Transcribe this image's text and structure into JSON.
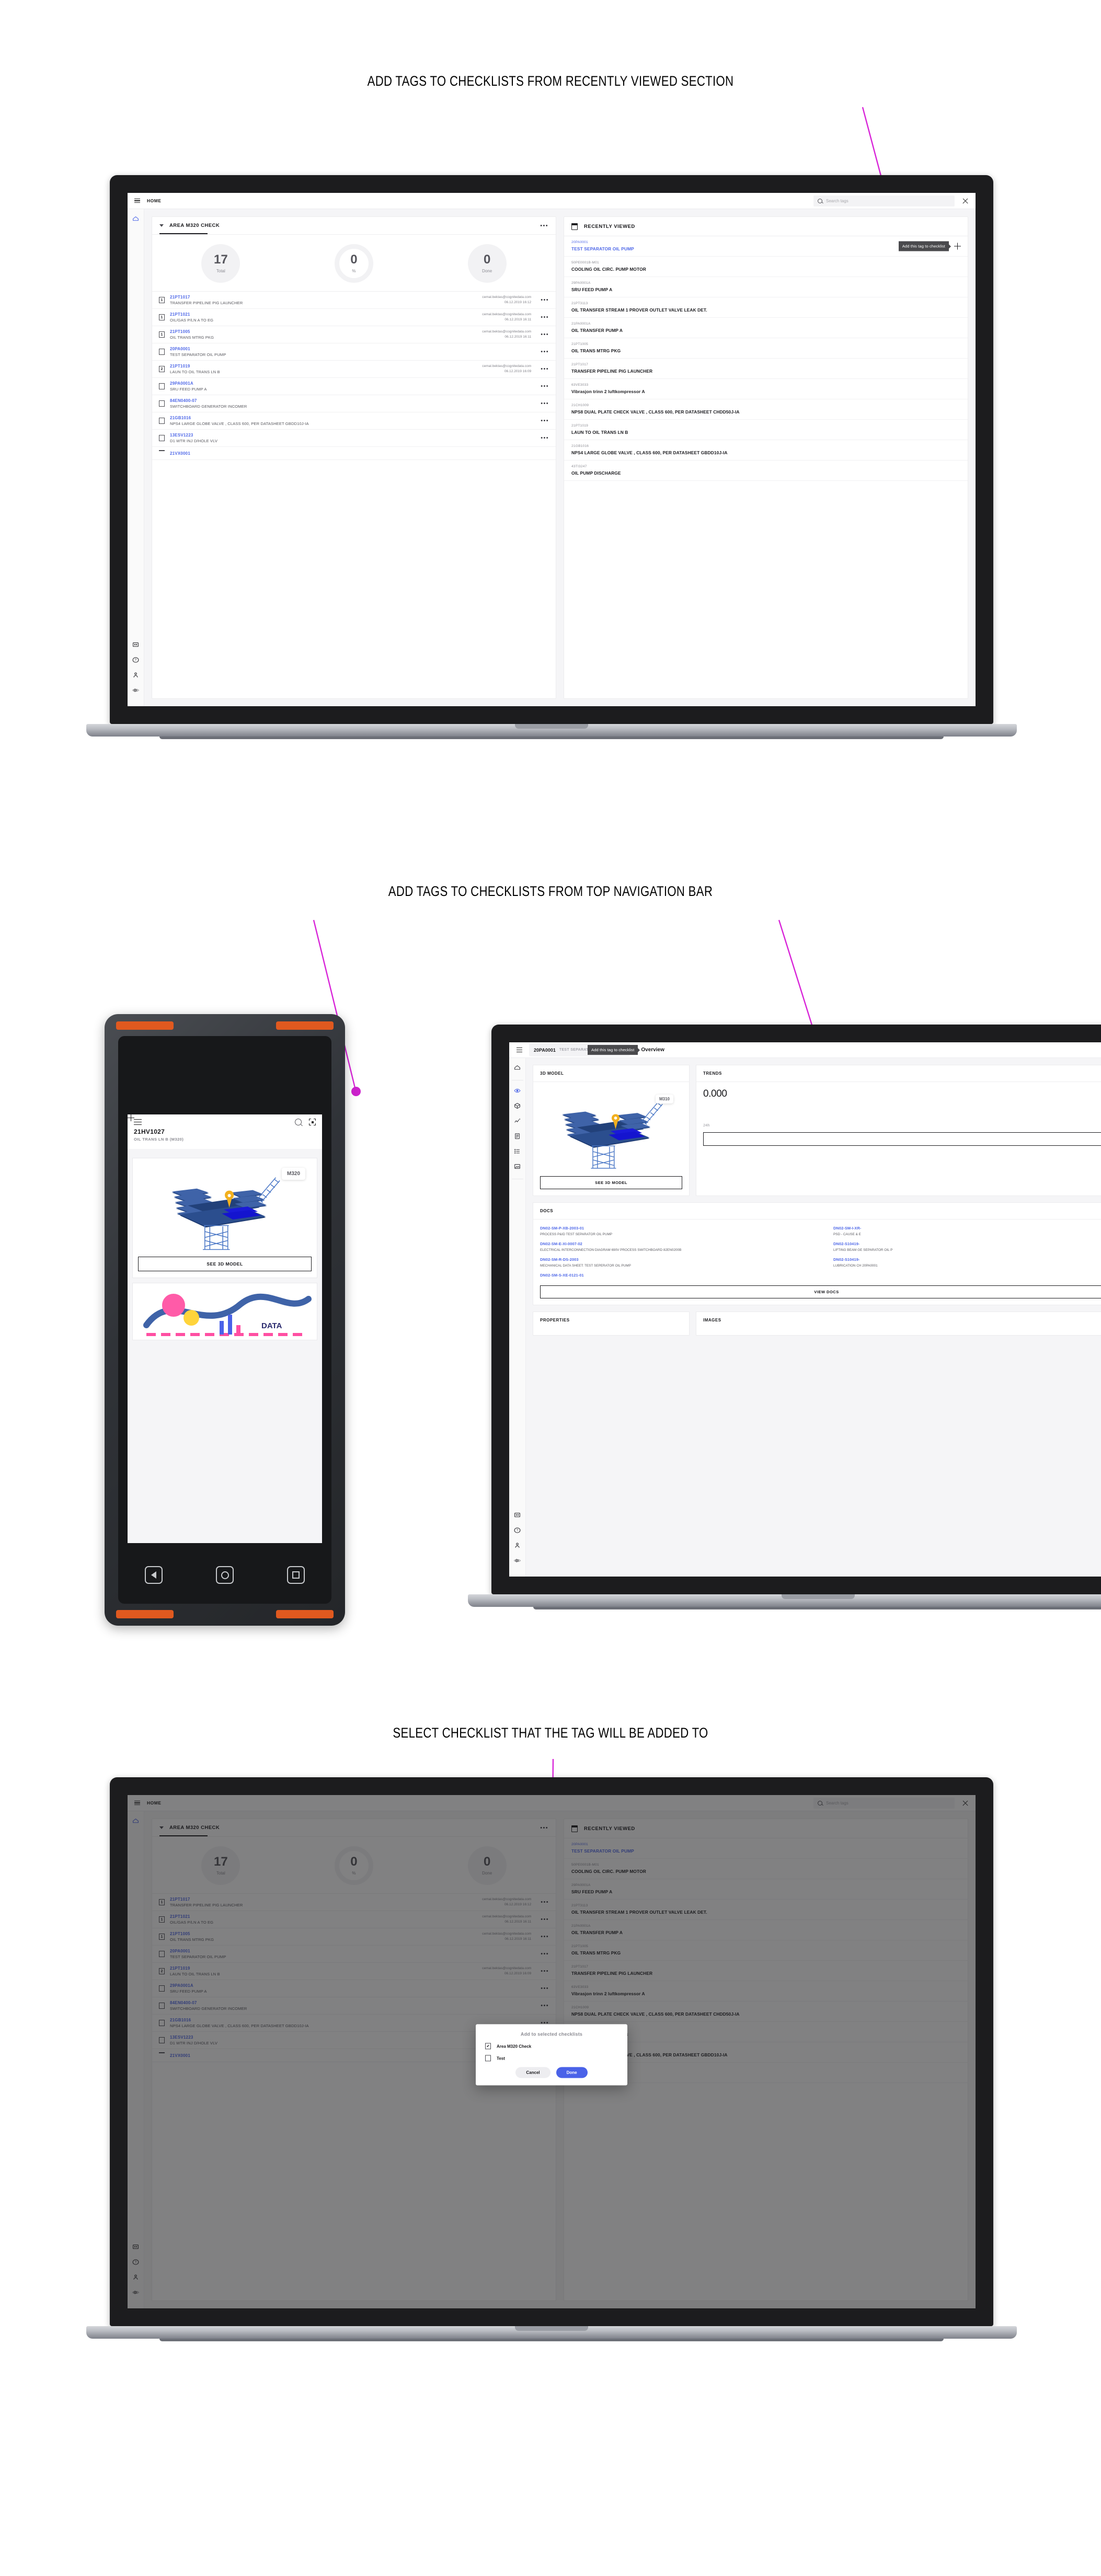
{
  "sections": [
    {
      "heading": "ADD TAGS TO CHECKLISTS FROM RECENTLY VIEWED SECTION"
    },
    {
      "heading": "ADD TAGS TO CHECKLISTS FROM TOP NAVIGATION BAR"
    },
    {
      "heading": "SELECT CHECKLIST THAT THE TAG WILL BE ADDED TO"
    }
  ],
  "colors": {
    "accent_blue": "#5069e8",
    "pointer_magenta": "#cc22cc",
    "primary_button": "#4a62e8"
  },
  "laptop1": {
    "topbar": {
      "title": "HOME",
      "search_placeholder": "Search tags",
      "menu_icon": "hamburger-icon",
      "search_icon": "search-icon",
      "scan_icon": "scan-icon",
      "close_icon": "close-icon"
    },
    "rail": [
      "home-icon",
      "comment-icon",
      "help-icon",
      "user-icon",
      "logo-icon"
    ],
    "checklist": {
      "title": "AREA M320 CHECK",
      "more_label": "•••",
      "stats": [
        {
          "value": "17",
          "label": "Total",
          "style": "filled"
        },
        {
          "value": "0",
          "label": "%",
          "style": "ring"
        },
        {
          "value": "0",
          "label": "Done",
          "style": "filled"
        }
      ],
      "rows": [
        {
          "mark": "1",
          "code": "21PT1017",
          "desc": "TRANSFER PIPELINE PIG LAUNCHER",
          "user": "cemal.bektas@cognitedata.com",
          "time": "06.12.2019 16:12"
        },
        {
          "mark": "1",
          "code": "21PT1021",
          "desc": "OIL/GAS P/LN A TO EG",
          "user": "cemal.bektas@cognitedata.com",
          "time": "06.12.2019 16:11"
        },
        {
          "mark": "1",
          "code": "21PT1005",
          "desc": "OIL TRANS MTRG PKG",
          "user": "cemal.bektas@cognitedata.com",
          "time": "06.12.2019 16:11"
        },
        {
          "mark": "",
          "code": "20PA0001",
          "desc": "TEST SEPARATOR OIL PUMP",
          "user": "",
          "time": ""
        },
        {
          "mark": "2",
          "code": "21PT1019",
          "desc": "LAUN TO OIL TRANS LN B",
          "user": "cemal.bektas@cognitedata.com",
          "time": "06.12.2019 16:09"
        },
        {
          "mark": "",
          "code": "29PA0001A",
          "desc": "SRU FEED PUMP A",
          "user": "",
          "time": ""
        },
        {
          "mark": "",
          "code": "84EN0400-07",
          "desc": "SWITCHBOARD GENERATOR INCOMER",
          "user": "",
          "time": ""
        },
        {
          "mark": "",
          "code": "21GB1016",
          "desc": "NPS4 LARGE GLOBE VALVE , CLASS 600, PER DATASHEET GBDD10J-IA",
          "user": "",
          "time": ""
        },
        {
          "mark": "",
          "code": "13ESV1223",
          "desc": "D1 WTR INJ D/HOLE VLV",
          "user": "",
          "time": ""
        },
        {
          "mark": "dash",
          "code": "21VX0001",
          "desc": "",
          "user": "",
          "time": ""
        }
      ]
    },
    "recently_viewed": {
      "title": "RECENTLY VIEWED",
      "icon": "calendar-icon",
      "tooltip": "Add this tag to checklist",
      "add_icon": "plus-icon",
      "rows": [
        {
          "code": "20PA0001",
          "name": "TEST SEPARATOR OIL PUMP",
          "active": true
        },
        {
          "code": "50PE0001B-M01",
          "name": "COOLING OIL CIRC. PUMP MOTOR",
          "active": false
        },
        {
          "code": "29PA0001A",
          "name": "SRU FEED PUMP A",
          "active": false
        },
        {
          "code": "21PT3113",
          "name": "OIL TRANSFER STREAM 1 PROVER OUTLET VALVE LEAK DET.",
          "active": false
        },
        {
          "code": "21PA0001A",
          "name": "OIL TRANSFER PUMP A",
          "active": false
        },
        {
          "code": "21PT1005",
          "name": "OIL TRANS MTRG PKG",
          "active": false
        },
        {
          "code": "21PT1017",
          "name": "TRANSFER PIPELINE PIG LAUNCHER",
          "active": false
        },
        {
          "code": "63VE3033",
          "name": "Vibrasjon trinn 2 luftkompressor A",
          "active": false
        },
        {
          "code": "21CH1009",
          "name": "NPS8 DUAL PLATE CHECK VALVE , CLASS 600, PER DATASHEET CHDD50J-IA",
          "active": false
        },
        {
          "code": "21PT1019",
          "name": "LAUN TO OIL TRANS LN B",
          "active": false
        },
        {
          "code": "21GB1016",
          "name": "NPS4 LARGE GLOBE VALVE , CLASS 600, PER DATASHEET GBDD10J-IA",
          "active": false
        },
        {
          "code": "43TI3247",
          "name": "OIL PUMP DISCHARGE",
          "active": false
        }
      ]
    }
  },
  "phone": {
    "menu_icon": "hamburger-icon",
    "search_icon": "search-icon",
    "scan_icon": "scan-icon",
    "add_icon": "plus-icon",
    "title": "21HV1027",
    "subtitle": "OIL TRANS LN B  (M320)",
    "model_badge": "M320",
    "see_3d_label": "SEE 3D MODEL",
    "nav": {
      "back_icon": "back-triangle-icon",
      "home_icon": "home-circle-icon",
      "recents_icon": "recents-square-icon"
    }
  },
  "laptop2": {
    "menu_icon": "hamburger-icon",
    "breadcrumb": {
      "code": "20PA0001",
      "desc": "TEST SEPARATOR OIL PUMP",
      "tooltip": "Add this tag to checklist",
      "add_icon": "plus-icon",
      "chevron": "›",
      "page": "Overview"
    },
    "rail": [
      "home-icon",
      "eye-icon",
      "cube-icon",
      "chart-icon",
      "document-icon",
      "list-icon",
      "image-icon",
      "comment-icon",
      "help-icon",
      "user-icon",
      "logo-icon"
    ],
    "model_card": {
      "title": "3D MODEL",
      "badge": "M310",
      "button": "SEE 3D MODEL"
    },
    "trends_card": {
      "title": "TRENDS",
      "value": "0.000",
      "range": "24h"
    },
    "docs_card": {
      "title": "DOCS",
      "button": "VIEW DOCS",
      "left": [
        {
          "code": "DN02-SM-P-XB-2003-01",
          "desc": "PROCESS P&ID TEST SEPARATOR OIL PUMP"
        },
        {
          "code": "DN02-SM-E-XI-0007-02",
          "desc": "ELECTRICAL INTERCONNECTION DIAGRAM 690V PROCESS SWITCHBOARD 82EN0200B"
        },
        {
          "code": "DN02-SM-R-DS-2003",
          "desc": "MECHANICAL DATA SHEET: TEST SEPERATOR OIL PUMP"
        },
        {
          "code": "DN02-SM-S-XE-0121-01",
          "desc": ""
        }
      ],
      "right": [
        {
          "code": "DN02-SM-I-XR-",
          "desc": "PSD - CAUSE & E"
        },
        {
          "code": "DN02-S10419-",
          "desc": "LIFTING BEAM GE SEPARATOR OIL P"
        },
        {
          "code": "DN02-S10419-",
          "desc": "LUBRICATION CH 20PA0001"
        }
      ]
    },
    "bottom_cards": [
      "PROPERTIES",
      "IMAGES"
    ]
  },
  "laptop3": {
    "topbar": {
      "title": "HOME",
      "search_placeholder": "Search tags"
    },
    "modal": {
      "title": "Add to selected checklists",
      "options": [
        {
          "label": "Area M320 Check",
          "checked": true
        },
        {
          "label": "Test",
          "checked": false
        }
      ],
      "cancel_label": "Cancel",
      "done_label": "Done"
    }
  }
}
